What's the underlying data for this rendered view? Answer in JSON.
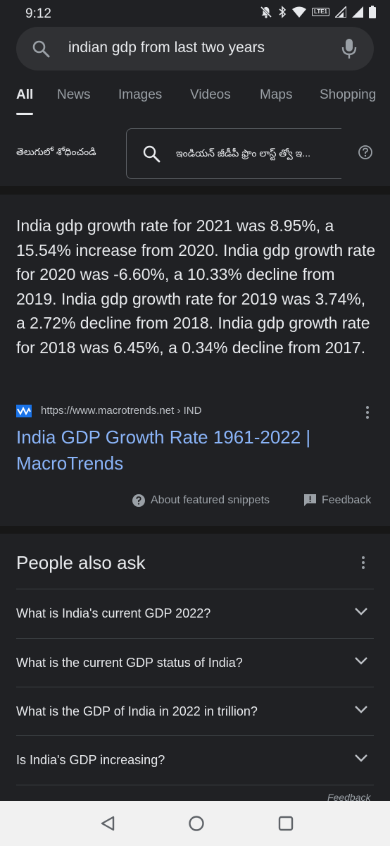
{
  "status": {
    "time": "9:12",
    "lte_label": "LTE1"
  },
  "search": {
    "query": "indian gdp from last two years"
  },
  "tabs": [
    {
      "label": "All",
      "active": true
    },
    {
      "label": "News"
    },
    {
      "label": "Images"
    },
    {
      "label": "Videos"
    },
    {
      "label": "Maps"
    },
    {
      "label": "Shopping"
    }
  ],
  "translate": {
    "language_label": "తెలుగులో శోధించండి",
    "suggestion": "ఇండియన్ జీడీపీ ఫ్రొం లాస్ట్ త్వో ఇ..."
  },
  "snippet": {
    "text": "India gdp growth rate for 2021 was 8.95%, a 15.54% increase from 2020. India gdp growth rate for 2020 was -6.60%, a 10.33% decline from 2019. India gdp growth rate for 2019 was 3.74%, a 2.72% decline from 2018. India gdp growth rate for 2018 was 6.45%, a 0.34% decline from 2017.",
    "source_url": "https://www.macrotrends.net › IND",
    "title": "India GDP Growth Rate 1961-2022 | MacroTrends",
    "about_label": "About featured snippets",
    "feedback_label": "Feedback"
  },
  "paa": {
    "title": "People also ask",
    "questions": [
      "What is India's current GDP 2022?",
      "What is the current GDP status of India?",
      "What is the GDP of India in 2022 in trillion?",
      "Is India's GDP increasing?"
    ],
    "feedback_label": "Feedback"
  },
  "colors": {
    "background": "#202124",
    "link": "#8ab4f8",
    "text": "#e8eaed",
    "muted": "#9aa0a6"
  }
}
